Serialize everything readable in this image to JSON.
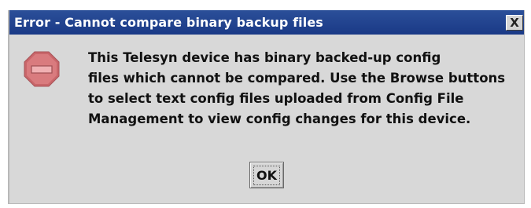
{
  "dialog": {
    "title": "Error - Cannot compare binary backup files",
    "close_glyph": "X",
    "icon": "stop-sign-icon",
    "message_lines": [
      "This Telesyn device has binary backed-up config",
      "files which cannot be compared. Use the Browse buttons",
      "to select text config files uploaded from Config File",
      "Management to view config changes for this device."
    ],
    "ok_label": "OK"
  },
  "colors": {
    "titlebar": "#1f4290",
    "dialog_bg": "#d8d8d8",
    "stop_icon": "#d9777a"
  }
}
